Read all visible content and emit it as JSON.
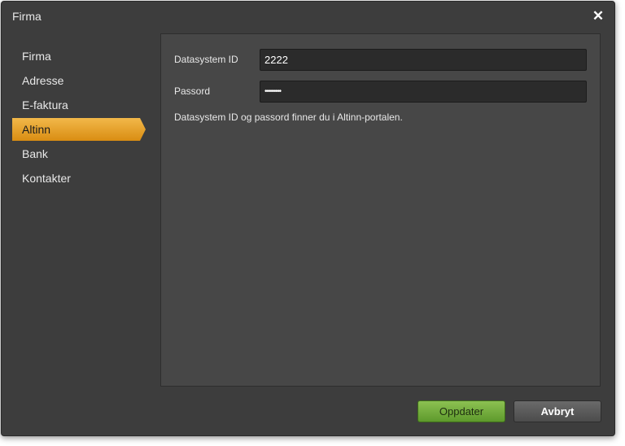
{
  "dialog": {
    "title": "Firma",
    "close_icon": "close-icon"
  },
  "sidebar": {
    "items": [
      {
        "label": "Firma"
      },
      {
        "label": "Adresse"
      },
      {
        "label": "E-faktura"
      },
      {
        "label": "Altinn",
        "active": true
      },
      {
        "label": "Bank"
      },
      {
        "label": "Kontakter"
      }
    ]
  },
  "form": {
    "datasystem_id": {
      "label": "Datasystem ID",
      "value": "2222"
    },
    "passord": {
      "label": "Passord",
      "value": "••••••••"
    },
    "hint": "Datasystem ID og passord finner du i Altinn-portalen."
  },
  "buttons": {
    "update": "Oppdater",
    "cancel": "Avbryt"
  },
  "colors": {
    "accent": "#e8a22a",
    "primary_button": "#7ab342"
  }
}
